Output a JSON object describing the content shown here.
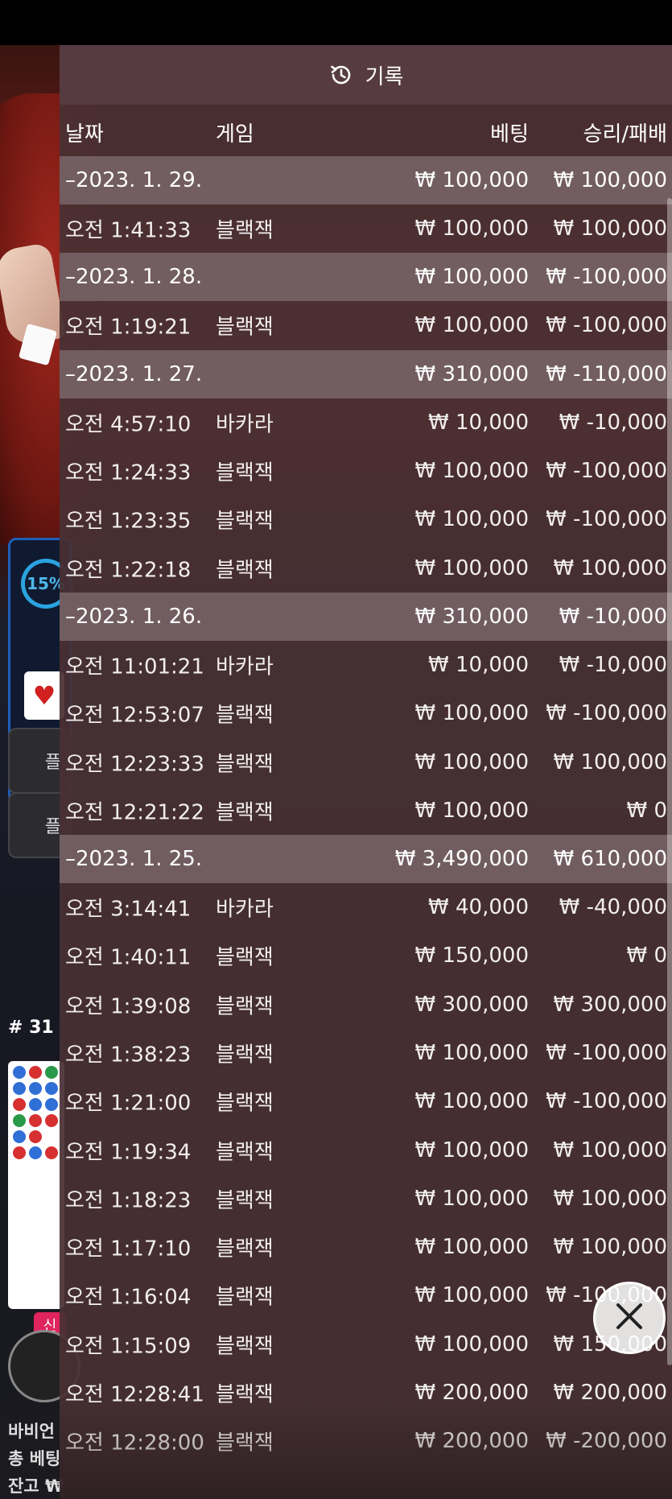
{
  "header": {
    "title": "기록",
    "icon": "history-icon"
  },
  "columns": {
    "date": "날짜",
    "game": "게임",
    "bet": "베팅",
    "result": "승리/패배"
  },
  "days": [
    {
      "date": "–2023. 1. 29.",
      "bet": "₩ 100,000",
      "result": "₩ 100,000",
      "entries": [
        {
          "time": "오전 1:41:33",
          "game": "블랙잭",
          "bet": "₩ 100,000",
          "result": "₩ 100,000"
        }
      ]
    },
    {
      "date": "–2023. 1. 28.",
      "bet": "₩ 100,000",
      "result": "₩ -100,000",
      "entries": [
        {
          "time": "오전 1:19:21",
          "game": "블랙잭",
          "bet": "₩ 100,000",
          "result": "₩ -100,000"
        }
      ]
    },
    {
      "date": "–2023. 1. 27.",
      "bet": "₩ 310,000",
      "result": "₩ -110,000",
      "entries": [
        {
          "time": "오전 4:57:10",
          "game": "바카라",
          "bet": "₩ 10,000",
          "result": "₩ -10,000"
        },
        {
          "time": "오전 1:24:33",
          "game": "블랙잭",
          "bet": "₩ 100,000",
          "result": "₩ -100,000"
        },
        {
          "time": "오전 1:23:35",
          "game": "블랙잭",
          "bet": "₩ 100,000",
          "result": "₩ -100,000"
        },
        {
          "time": "오전 1:22:18",
          "game": "블랙잭",
          "bet": "₩ 100,000",
          "result": "₩ 100,000"
        }
      ]
    },
    {
      "date": "–2023. 1. 26.",
      "bet": "₩ 310,000",
      "result": "₩ -10,000",
      "entries": [
        {
          "time": "오전 11:01:21",
          "game": "바카라",
          "bet": "₩ 10,000",
          "result": "₩ -10,000"
        },
        {
          "time": "오전 12:53:07",
          "game": "블랙잭",
          "bet": "₩ 100,000",
          "result": "₩ -100,000"
        },
        {
          "time": "오전 12:23:33",
          "game": "블랙잭",
          "bet": "₩ 100,000",
          "result": "₩ 100,000"
        },
        {
          "time": "오전 12:21:22",
          "game": "블랙잭",
          "bet": "₩ 100,000",
          "result": "₩ 0"
        }
      ]
    },
    {
      "date": "–2023. 1. 25.",
      "bet": "₩ 3,490,000",
      "result": "₩ 610,000",
      "entries": [
        {
          "time": "오전 3:14:41",
          "game": "바카라",
          "bet": "₩ 40,000",
          "result": "₩ -40,000"
        },
        {
          "time": "오전 1:40:11",
          "game": "블랙잭",
          "bet": "₩ 150,000",
          "result": "₩ 0"
        },
        {
          "time": "오전 1:39:08",
          "game": "블랙잭",
          "bet": "₩ 300,000",
          "result": "₩ 300,000"
        },
        {
          "time": "오전 1:38:23",
          "game": "블랙잭",
          "bet": "₩ 100,000",
          "result": "₩ -100,000"
        },
        {
          "time": "오전 1:21:00",
          "game": "블랙잭",
          "bet": "₩ 100,000",
          "result": "₩ -100,000"
        },
        {
          "time": "오전 1:19:34",
          "game": "블랙잭",
          "bet": "₩ 100,000",
          "result": "₩ 100,000"
        },
        {
          "time": "오전 1:18:23",
          "game": "블랙잭",
          "bet": "₩ 100,000",
          "result": "₩ 100,000"
        },
        {
          "time": "오전 1:17:10",
          "game": "블랙잭",
          "bet": "₩ 100,000",
          "result": "₩ 100,000"
        },
        {
          "time": "오전 1:16:04",
          "game": "블랙잭",
          "bet": "₩ 100,000",
          "result": "₩ -100,000"
        },
        {
          "time": "오전 1:15:09",
          "game": "블랙잭",
          "bet": "₩ 100,000",
          "result": "₩ 150,000"
        },
        {
          "time": "오전 12:28:41",
          "game": "블랙잭",
          "bet": "₩ 200,000",
          "result": "₩ 200,000"
        },
        {
          "time": "오전 12:28:00",
          "game": "블랙잭",
          "bet": "₩ 200,000",
          "result": "₩ -200,000"
        }
      ]
    }
  ],
  "background": {
    "progress_label": "15%",
    "round_label": "# 31",
    "new_badge": "신",
    "text_lines": [
      "바비언",
      "총 베팅",
      "잔고 ₩"
    ]
  },
  "close_button": {
    "icon": "close-icon"
  },
  "colors": {
    "panel": "#48303a",
    "day_row": "#78646a",
    "text": "#ffffff",
    "accent_blue": "#2ba3e0"
  }
}
